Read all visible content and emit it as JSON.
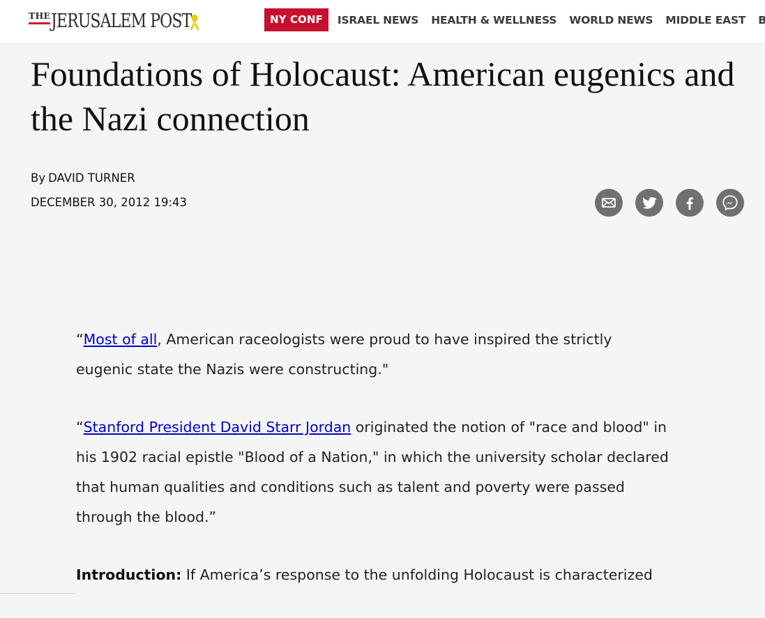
{
  "header": {
    "logo_the": "THE",
    "logo_name": "JERUSALEM POST",
    "badge": "NY CONF",
    "nav": [
      "ISRAEL NEWS",
      "HEALTH & WELLNESS",
      "WORLD NEWS",
      "MIDDLE EAST",
      "BUSIN"
    ]
  },
  "article": {
    "title": "Foundations of Holocaust: American eugenics and the Nazi connection",
    "by_prefix": "By",
    "author": "DAVID TURNER",
    "date": "DECEMBER 30, 2012 19:43",
    "p1": {
      "open_quote": "“",
      "link": "Most of all",
      "text": ", American raceologists were proud to have inspired the strictly eugenic state the Nazis were constructing.\""
    },
    "p2": {
      "open_quote": "“",
      "link": "Stanford President David Starr Jordan",
      "text": " originated the notion of \"race and blood\" in his 1902 racial epistle \"Blood of a Nation,\" in which the university scholar declared that human qualities and conditions such as talent and poverty were passed through the blood.”"
    },
    "p3": {
      "label": "Introduction:",
      "text": " If America’s response to the unfolding Holocaust is characterized"
    }
  },
  "share": {
    "icons": [
      "email-icon",
      "twitter-icon",
      "facebook-icon",
      "messenger-icon"
    ]
  },
  "colors": {
    "brand_red": "#c8102e",
    "link": "#0000cc",
    "icon_gray": "#707070",
    "background": "#f5f5f5"
  }
}
